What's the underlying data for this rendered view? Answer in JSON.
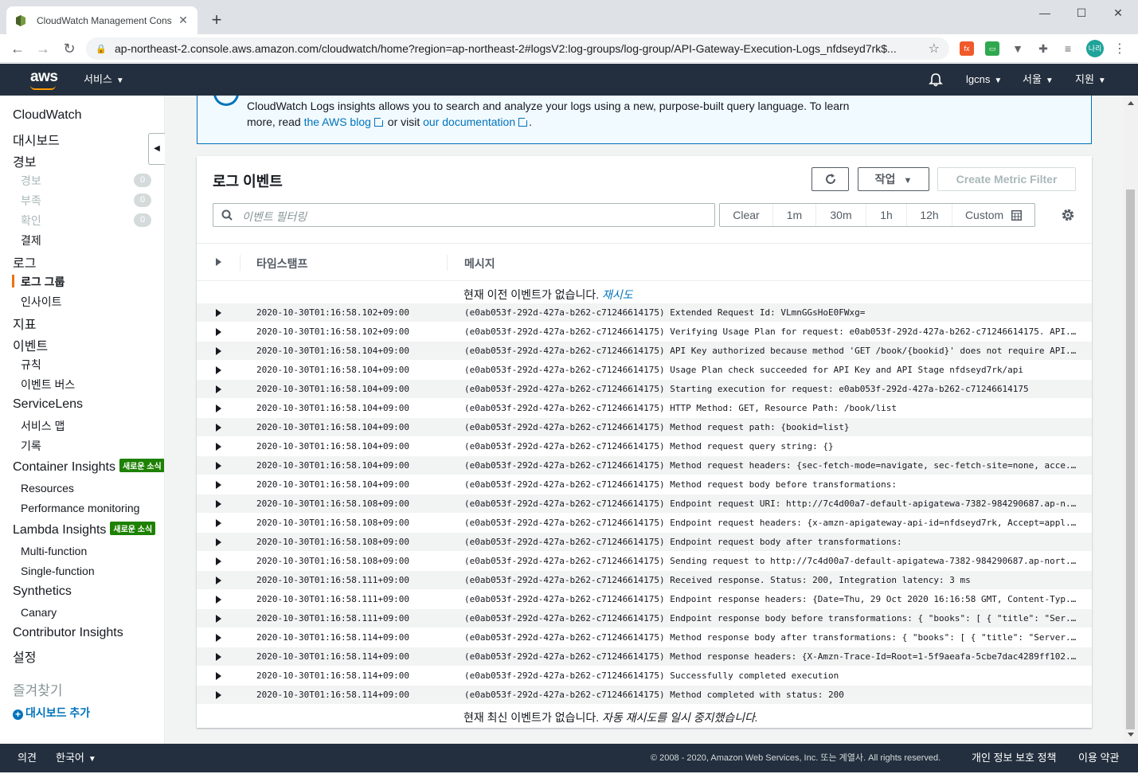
{
  "browser": {
    "tab_title": "CloudWatch Management Cons",
    "url": "ap-northeast-2.console.aws.amazon.com/cloudwatch/home?region=ap-northeast-2#logsV2:log-groups/log-group/API-Gateway-Execution-Logs_nfdseyd7rk$...",
    "avatar_label": "나리"
  },
  "header": {
    "logo": "aws",
    "services": "서비스",
    "account": "lgcns",
    "region": "서울",
    "support": "지원"
  },
  "sidebar": {
    "cloudwatch": "CloudWatch",
    "dashboard": "대시보드",
    "alarms": "경보",
    "alarm_sub": [
      {
        "label": "경보",
        "count": "0"
      },
      {
        "label": "부족",
        "count": "0"
      },
      {
        "label": "확인",
        "count": "0"
      }
    ],
    "billing": "결제",
    "logs": "로그",
    "log_groups": "로그 그룹",
    "insights": "인사이트",
    "metrics": "지표",
    "events": "이벤트",
    "rules": "규칙",
    "event_buses": "이벤트 버스",
    "servicelens": "ServiceLens",
    "service_map": "서비스 맵",
    "traces": "기록",
    "container_insights": "Container Insights",
    "new_badge": "새로운 소식",
    "resources": "Resources",
    "performance_monitoring": "Performance monitoring",
    "lambda_insights": "Lambda Insights",
    "multi_function": "Multi-function",
    "single_function": "Single-function",
    "synthetics": "Synthetics",
    "canary": "Canary",
    "contributor_insights": "Contributor Insights",
    "settings": "설정",
    "favorites": "즐겨찾기",
    "add_dashboard": "대시보드 추가"
  },
  "info": {
    "text_1": "CloudWatch Logs insights allows you to search and analyze your logs using a new, purpose-built query language. To learn more, read",
    "blog_link": "the AWS blog",
    "or_visit": "or visit",
    "docs_link": "our documentation",
    "period": "."
  },
  "panel": {
    "title": "로그 이벤트",
    "actions": "작업",
    "create_metric_filter": "Create Metric Filter",
    "filter_placeholder": "이벤트 필터링",
    "time_ranges": [
      "Clear",
      "1m",
      "30m",
      "1h",
      "12h"
    ],
    "custom": "Custom",
    "col_timestamp": "타임스탬프",
    "col_message": "메시지",
    "no_older": "현재 이전 이벤트가 없습니다.",
    "retry": "재시도",
    "no_newer": "현재 최신 이벤트가 없습니다.",
    "auto_retry": "자동 재시도를 일시 중지했습니다."
  },
  "log_rows": [
    {
      "ts": "2020-10-30T01:16:58.102+09:00",
      "msg": "(e0ab053f-292d-427a-b262-c71246614175) Extended Request Id: VLmnGGsHoE0FWxg="
    },
    {
      "ts": "2020-10-30T01:16:58.102+09:00",
      "msg": "(e0ab053f-292d-427a-b262-c71246614175) Verifying Usage Plan for request: e0ab053f-292d-427a-b262-c71246614175. API..."
    },
    {
      "ts": "2020-10-30T01:16:58.104+09:00",
      "msg": "(e0ab053f-292d-427a-b262-c71246614175) API Key authorized because method 'GET /book/{bookid}' does not require API..."
    },
    {
      "ts": "2020-10-30T01:16:58.104+09:00",
      "msg": "(e0ab053f-292d-427a-b262-c71246614175) Usage Plan check succeeded for API Key and API Stage nfdseyd7rk/api"
    },
    {
      "ts": "2020-10-30T01:16:58.104+09:00",
      "msg": "(e0ab053f-292d-427a-b262-c71246614175) Starting execution for request: e0ab053f-292d-427a-b262-c71246614175"
    },
    {
      "ts": "2020-10-30T01:16:58.104+09:00",
      "msg": "(e0ab053f-292d-427a-b262-c71246614175) HTTP Method: GET, Resource Path: /book/list"
    },
    {
      "ts": "2020-10-30T01:16:58.104+09:00",
      "msg": "(e0ab053f-292d-427a-b262-c71246614175) Method request path: {bookid=list}"
    },
    {
      "ts": "2020-10-30T01:16:58.104+09:00",
      "msg": "(e0ab053f-292d-427a-b262-c71246614175) Method request query string: {}"
    },
    {
      "ts": "2020-10-30T01:16:58.104+09:00",
      "msg": "(e0ab053f-292d-427a-b262-c71246614175) Method request headers: {sec-fetch-mode=navigate, sec-fetch-site=none, acce..."
    },
    {
      "ts": "2020-10-30T01:16:58.104+09:00",
      "msg": "(e0ab053f-292d-427a-b262-c71246614175) Method request body before transformations:"
    },
    {
      "ts": "2020-10-30T01:16:58.108+09:00",
      "msg": "(e0ab053f-292d-427a-b262-c71246614175) Endpoint request URI: http://7c4d00a7-default-apigatewa-7382-984290687.ap-n..."
    },
    {
      "ts": "2020-10-30T01:16:58.108+09:00",
      "msg": "(e0ab053f-292d-427a-b262-c71246614175) Endpoint request headers: {x-amzn-apigateway-api-id=nfdseyd7rk, Accept=appl..."
    },
    {
      "ts": "2020-10-30T01:16:58.108+09:00",
      "msg": "(e0ab053f-292d-427a-b262-c71246614175) Endpoint request body after transformations:"
    },
    {
      "ts": "2020-10-30T01:16:58.108+09:00",
      "msg": "(e0ab053f-292d-427a-b262-c71246614175) Sending request to http://7c4d00a7-default-apigatewa-7382-984290687.ap-nort..."
    },
    {
      "ts": "2020-10-30T01:16:58.111+09:00",
      "msg": "(e0ab053f-292d-427a-b262-c71246614175) Received response. Status: 200, Integration latency: 3 ms"
    },
    {
      "ts": "2020-10-30T01:16:58.111+09:00",
      "msg": "(e0ab053f-292d-427a-b262-c71246614175) Endpoint response headers: {Date=Thu, 29 Oct 2020 16:16:58 GMT, Content-Typ..."
    },
    {
      "ts": "2020-10-30T01:16:58.111+09:00",
      "msg": "(e0ab053f-292d-427a-b262-c71246614175) Endpoint response body before transformations: { \"books\": [ { \"title\": \"Ser..."
    },
    {
      "ts": "2020-10-30T01:16:58.114+09:00",
      "msg": "(e0ab053f-292d-427a-b262-c71246614175) Method response body after transformations: { \"books\": [ { \"title\": \"Server..."
    },
    {
      "ts": "2020-10-30T01:16:58.114+09:00",
      "msg": "(e0ab053f-292d-427a-b262-c71246614175) Method response headers: {X-Amzn-Trace-Id=Root=1-5f9aeafa-5cbe7dac4289ff102..."
    },
    {
      "ts": "2020-10-30T01:16:58.114+09:00",
      "msg": "(e0ab053f-292d-427a-b262-c71246614175) Successfully completed execution"
    },
    {
      "ts": "2020-10-30T01:16:58.114+09:00",
      "msg": "(e0ab053f-292d-427a-b262-c71246614175) Method completed with status: 200"
    }
  ],
  "footer": {
    "feedback": "의견",
    "language": "한국어",
    "copyright": "© 2008 - 2020, Amazon Web Services, Inc. 또는 계열사. All rights reserved.",
    "privacy": "개인 정보 보호 정책",
    "terms": "이용 약관"
  },
  "colors": {
    "aws_header": "#232f3e",
    "accent_orange": "#ec7211",
    "link_blue": "#0073bb",
    "new_badge_green": "#1d8102"
  }
}
